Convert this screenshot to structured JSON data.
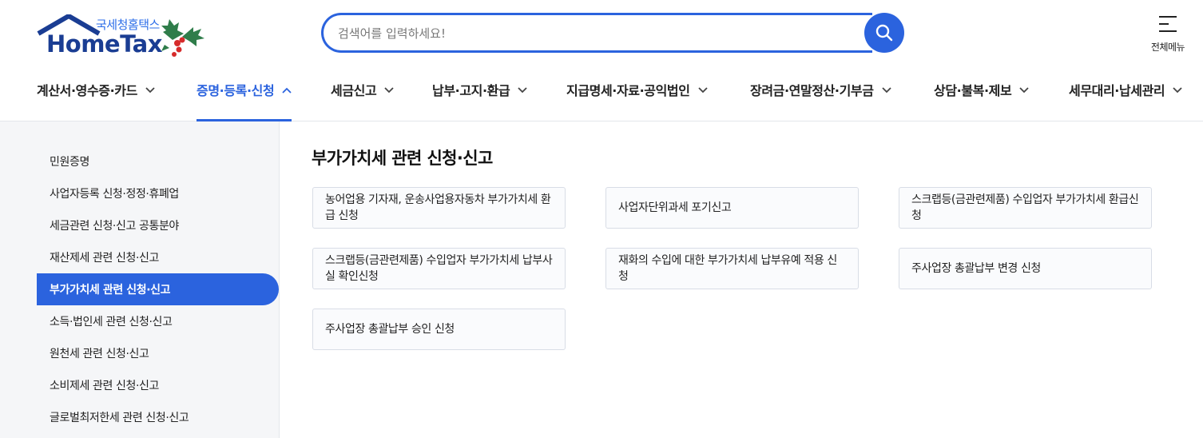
{
  "header": {
    "logo_sub": "국세청홈택스",
    "logo_main": "HomeTax",
    "search_placeholder": "검색어를 입력하세요!",
    "all_menu_label": "전체메뉴"
  },
  "gnb": {
    "items": [
      {
        "label": "계산서·영수증·카드",
        "expanded": false
      },
      {
        "label": "증명·등록·신청",
        "expanded": true
      },
      {
        "label": "세금신고",
        "expanded": false
      },
      {
        "label": "납부·고지·환급",
        "expanded": false
      },
      {
        "label": "지급명세·자료·공익법인",
        "expanded": false
      },
      {
        "label": "장려금·연말정산·기부금",
        "expanded": false
      },
      {
        "label": "상담·불복·제보",
        "expanded": false
      },
      {
        "label": "세무대리·납세관리",
        "expanded": false
      }
    ]
  },
  "sidebar": {
    "items": [
      {
        "label": "민원증명"
      },
      {
        "label": "사업자등록 신청·정정·휴폐업"
      },
      {
        "label": "세금관련 신청·신고 공통분야"
      },
      {
        "label": "재산제세 관련 신청·신고"
      },
      {
        "label": "부가가치세 관련 신청·신고",
        "active": true
      },
      {
        "label": "소득·법인세 관련 신청·신고"
      },
      {
        "label": "원천세 관련 신청·신고"
      },
      {
        "label": "소비제세 관련 신청·신고"
      },
      {
        "label": "글로벌최저한세 관련 신청·신고"
      }
    ]
  },
  "content": {
    "title": "부가가치세 관련 신청·신고",
    "cards": [
      {
        "label": "농어업용 기자재, 운송사업용자동차 부가가치세 환급 신청"
      },
      {
        "label": "사업자단위과세 포기신고"
      },
      {
        "label": "스크랩등(금관련제품) 수입업자 부가가치세 환급신청"
      },
      {
        "label": "스크랩등(금관련제품) 수입업자 부가가치세 납부사실 확인신청"
      },
      {
        "label": "재화의 수입에 대한 부가가치세 납부유예 적용 신청"
      },
      {
        "label": "주사업장 총괄납부 변경 신청"
      },
      {
        "label": "주사업장 총괄납부 승인 신청"
      }
    ]
  },
  "colors": {
    "accent": "#2b63de",
    "logo_navy": "#1a3d93",
    "sidebar_bg": "#f5f6f8",
    "card_border": "#d8dde6"
  },
  "icons": [
    "house-roof-icon",
    "holly-icon",
    "search-icon",
    "hamburger-menu-icon",
    "chevron-down-icon",
    "chevron-up-icon"
  ]
}
